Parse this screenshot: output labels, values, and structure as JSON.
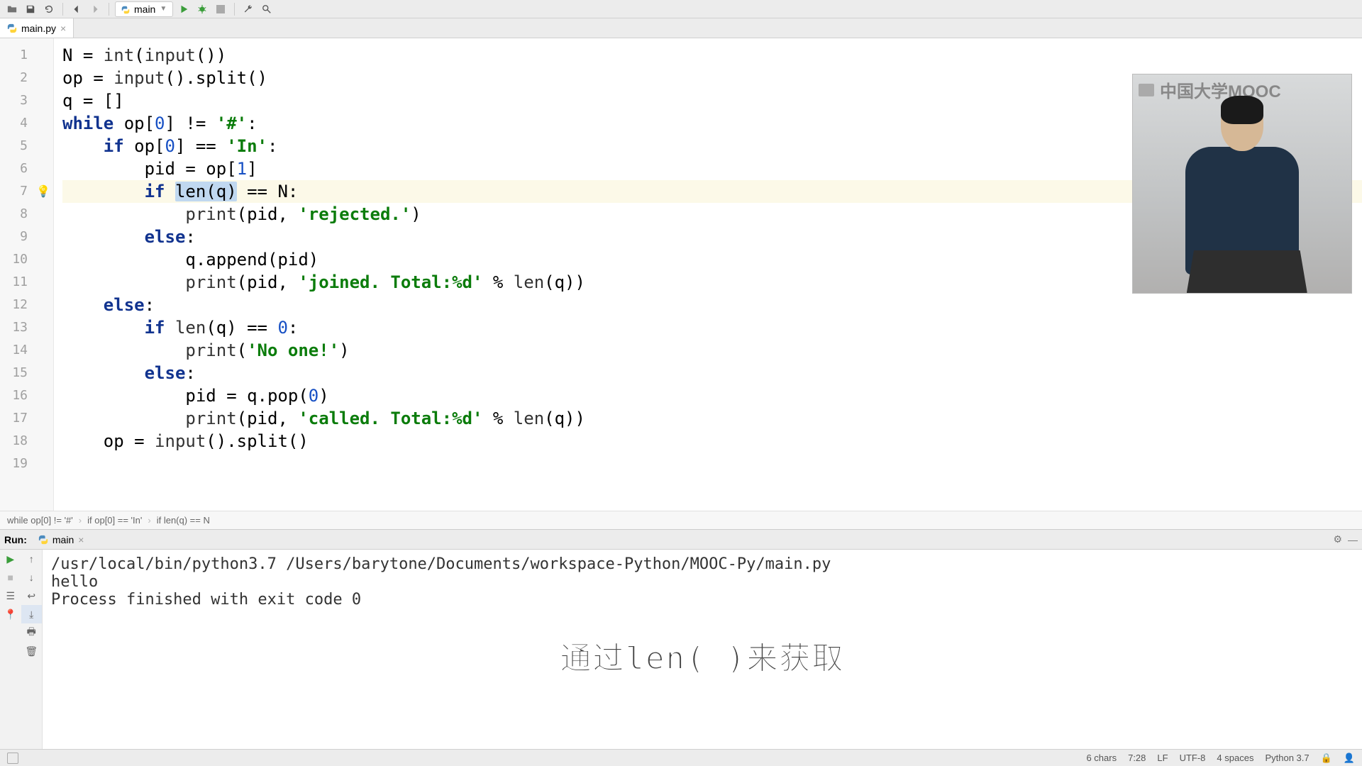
{
  "toolbar": {
    "run_config_label": "main"
  },
  "tab": {
    "filename": "main.py"
  },
  "code": {
    "lines": [
      {
        "n": 1
      },
      {
        "n": 2
      },
      {
        "n": 3
      },
      {
        "n": 4
      },
      {
        "n": 5
      },
      {
        "n": 6
      },
      {
        "n": 7,
        "bulb": true,
        "hl": true
      },
      {
        "n": 8
      },
      {
        "n": 9
      },
      {
        "n": 10
      },
      {
        "n": 11
      },
      {
        "n": 12
      },
      {
        "n": 13
      },
      {
        "n": 14
      },
      {
        "n": 15
      },
      {
        "n": 16
      },
      {
        "n": 17
      },
      {
        "n": 18
      },
      {
        "n": 19
      }
    ],
    "source": {
      "l1_a": "N = ",
      "l1_b": "int",
      "l1_c": "(",
      "l1_d": "input",
      "l1_e": "())",
      "l2_a": "op = ",
      "l2_b": "input",
      "l2_c": "().split()",
      "l3": "q = []",
      "l4_a": "while",
      "l4_b": " op[",
      "l4_c": "0",
      "l4_d": "] != ",
      "l4_e": "'#'",
      "l4_f": ":",
      "l5_a": "    ",
      "l5_b": "if",
      "l5_c": " op[",
      "l5_d": "0",
      "l5_e": "] == ",
      "l5_f": "'In'",
      "l5_g": ":",
      "l6_a": "        pid = op[",
      "l6_b": "1",
      "l6_c": "]",
      "l7_a": "        ",
      "l7_b": "if",
      "l7_c": " ",
      "l7_sel": "len(q)",
      "l7_d": " == N:",
      "l8_a": "            ",
      "l8_b": "print",
      "l8_c": "(pid, ",
      "l8_d": "'rejected.'",
      "l8_e": ")",
      "l9_a": "        ",
      "l9_b": "else",
      "l9_c": ":",
      "l10_a": "            q.append(pid)",
      "l11_a": "            ",
      "l11_b": "print",
      "l11_c": "(pid, ",
      "l11_d": "'joined. Total:%d'",
      "l11_e": " % ",
      "l11_f": "len",
      "l11_g": "(q))",
      "l12_a": "    ",
      "l12_b": "else",
      "l12_c": ":",
      "l13_a": "        ",
      "l13_b": "if",
      "l13_c": " ",
      "l13_d": "len",
      "l13_e": "(q) == ",
      "l13_f": "0",
      "l13_g": ":",
      "l14_a": "            ",
      "l14_b": "print",
      "l14_c": "(",
      "l14_d": "'No one!'",
      "l14_e": ")",
      "l15_a": "        ",
      "l15_b": "else",
      "l15_c": ":",
      "l16_a": "            pid = q.pop(",
      "l16_b": "0",
      "l16_c": ")",
      "l17_a": "            ",
      "l17_b": "print",
      "l17_c": "(pid, ",
      "l17_d": "'called. Total:%d'",
      "l17_e": " % ",
      "l17_f": "len",
      "l17_g": "(q))",
      "l18_a": "    op = ",
      "l18_b": "input",
      "l18_c": "().split()"
    }
  },
  "breadcrumb": {
    "items": [
      "while op[0] != '#'",
      "if op[0] == 'In'",
      "if len(q) == N"
    ]
  },
  "run": {
    "label": "Run:",
    "config": "main",
    "console_line1": "/usr/local/bin/python3.7 /Users/barytone/Documents/workspace-Python/MOOC-Py/main.py",
    "console_line2": "hello",
    "console_line3": "",
    "console_line4": "Process finished with exit code 0"
  },
  "overlay": {
    "mooc": "中国大学MOOC",
    "subtitle": "通过len( )来获取"
  },
  "status": {
    "chars": "6 chars",
    "pos": "7:28",
    "line_ending": "LF",
    "encoding": "UTF-8",
    "indent": "4 spaces",
    "interpreter": "Python 3.7"
  }
}
